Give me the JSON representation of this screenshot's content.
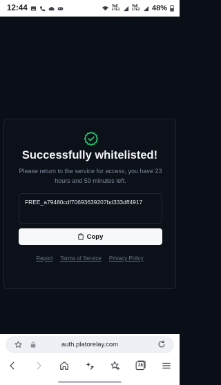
{
  "status_bar": {
    "time": "12:44",
    "left_icons": [
      "gallery-icon",
      "phone-icon",
      "cloud-icon",
      "game-icon"
    ],
    "right_icons": [
      "wifi-icon",
      "volte-lte1-icon",
      "volte-lte2-icon"
    ],
    "volte1": "Vo0 LTE1",
    "volte2": "Vo0 LTE2",
    "battery": "48%"
  },
  "card": {
    "title": "Successfully whitelisted!",
    "subtitle": "Please return to the service for access, you have 23 hours and 59 minutes left.",
    "key": "FREE_a79480cdf70693639207bd333dff4917",
    "copy_label": "Copy",
    "links": {
      "report": "Report",
      "terms": "Terms of Service",
      "privacy": "Privacy Policy"
    },
    "accent_color": "#27c26b"
  },
  "browser": {
    "url": "auth.platorelay.com",
    "tab_count": "28"
  }
}
